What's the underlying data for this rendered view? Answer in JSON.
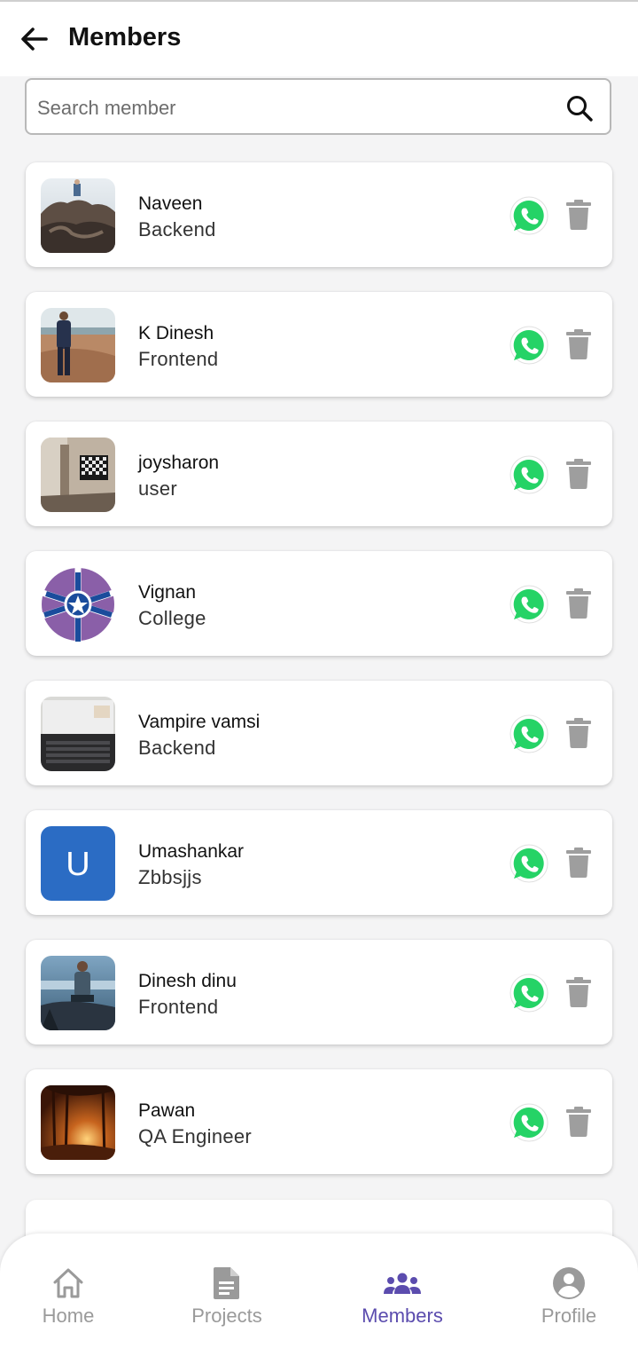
{
  "header": {
    "title": "Members"
  },
  "search": {
    "placeholder": "Search member"
  },
  "members": [
    {
      "name": "Naveen",
      "role": "Backend",
      "avatar": "photo-rocks"
    },
    {
      "name": "K Dinesh",
      "role": "Frontend",
      "avatar": "photo-beach"
    },
    {
      "name": "joysharon",
      "role": "user",
      "avatar": "photo-room"
    },
    {
      "name": "Vignan",
      "role": "College",
      "avatar": "logo-vignan"
    },
    {
      "name": "Vampire vamsi",
      "role": "Backend",
      "avatar": "photo-laptop"
    },
    {
      "name": "Umashankar",
      "role": "Zbbsjjs",
      "avatar": "initial",
      "initial": "U"
    },
    {
      "name": "Dinesh dinu",
      "role": "Frontend",
      "avatar": "photo-seaside"
    },
    {
      "name": "Pawan",
      "role": "QA Engineer",
      "avatar": "photo-sunset-forest"
    }
  ],
  "nav": [
    {
      "label": "Home",
      "icon": "home-icon",
      "active": false
    },
    {
      "label": "Projects",
      "icon": "document-icon",
      "active": false
    },
    {
      "label": "Members",
      "icon": "group-icon",
      "active": true
    },
    {
      "label": "Profile",
      "icon": "account-circle-icon",
      "active": false
    }
  ],
  "colors": {
    "accent": "#5b4cae",
    "whatsapp": "#25d366",
    "delete_icon": "#9e9e9e",
    "initial_avatar": "#2b6cc4"
  }
}
